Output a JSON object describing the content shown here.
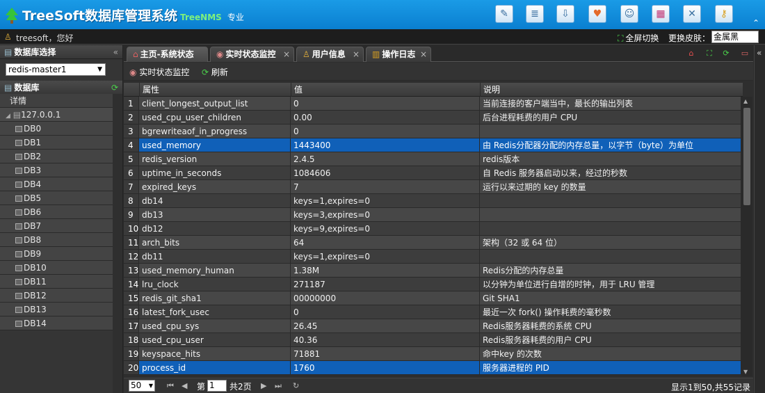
{
  "header": {
    "brand": "TreeSoft数据库管理系统",
    "brand_sub": "TreeNMS",
    "edition": "专业",
    "icons": [
      "edit-icon",
      "list-icon",
      "download-icon",
      "heart-icon",
      "user-icon",
      "calendar-icon",
      "tools-icon",
      "key-icon"
    ]
  },
  "userbar": {
    "greeting": "treesoft，您好",
    "fullscreen": "全屏切换",
    "skin_label": "更换皮肤：",
    "skin_value": "金属黑"
  },
  "left": {
    "db_select_title": "数据库选择",
    "db_select_value": "redis-master1",
    "database_title": "数据库",
    "detail": "详情",
    "root": "127.0.0.1",
    "dbs": [
      "DB0",
      "DB1",
      "DB2",
      "DB3",
      "DB4",
      "DB5",
      "DB6",
      "DB7",
      "DB8",
      "DB9",
      "DB10",
      "DB11",
      "DB12",
      "DB13",
      "DB14"
    ]
  },
  "tabs": [
    {
      "label": "主页-系统状态",
      "icon": "home-icon"
    },
    {
      "label": "实时状态监控",
      "icon": "monitor-icon"
    },
    {
      "label": "用户信息",
      "icon": "user-icon"
    },
    {
      "label": "操作日志",
      "icon": "log-icon"
    }
  ],
  "toolbar": {
    "monitor": "实时状态监控",
    "refresh": "刷新"
  },
  "grid": {
    "columns": [
      "属性",
      "值",
      "说明"
    ],
    "rows": [
      [
        "1",
        "client_longest_output_list",
        "0",
        "当前连接的客户端当中，最长的输出列表"
      ],
      [
        "2",
        "used_cpu_user_children",
        "0.00",
        "后台进程耗费的用户 CPU"
      ],
      [
        "3",
        "bgrewriteaof_in_progress",
        "0",
        ""
      ],
      [
        "4",
        "used_memory",
        "1443400",
        "由 Redis分配器分配的内存总量，以字节（byte）为单位"
      ],
      [
        "5",
        "redis_version",
        "2.4.5",
        "redis版本"
      ],
      [
        "6",
        "uptime_in_seconds",
        "1084606",
        "自 Redis 服务器启动以来，经过的秒数"
      ],
      [
        "7",
        "expired_keys",
        "7",
        "运行以来过期的 key 的数量"
      ],
      [
        "8",
        "db14",
        "keys=1,expires=0",
        ""
      ],
      [
        "9",
        "db13",
        "keys=3,expires=0",
        ""
      ],
      [
        "10",
        "db12",
        "keys=9,expires=0",
        ""
      ],
      [
        "11",
        "arch_bits",
        "64",
        "架构（32 或 64 位）"
      ],
      [
        "12",
        "db11",
        "keys=1,expires=0",
        ""
      ],
      [
        "13",
        "used_memory_human",
        "1.38M",
        "Redis分配的内存总量"
      ],
      [
        "14",
        "lru_clock",
        "271187",
        "以分钟为单位进行自增的时钟，用于 LRU 管理"
      ],
      [
        "15",
        "redis_git_sha1",
        "00000000",
        "Git SHA1"
      ],
      [
        "16",
        "latest_fork_usec",
        "0",
        "最近一次 fork() 操作耗费的毫秒数"
      ],
      [
        "17",
        "used_cpu_sys",
        "26.45",
        "Redis服务器耗费的系统 CPU"
      ],
      [
        "18",
        "used_cpu_user",
        "40.36",
        "Redis服务器耗费的用户 CPU"
      ],
      [
        "19",
        "keyspace_hits",
        "71881",
        "命中key 的次数"
      ],
      [
        "20",
        "process_id",
        "1760",
        "服务器进程的 PID"
      ]
    ],
    "selected_rows": [
      "4",
      "20"
    ]
  },
  "pager": {
    "page_size": "50",
    "page_prefix": "第",
    "page_value": "1",
    "page_suffix": "共2页",
    "info": "显示1到50,共55记录"
  }
}
